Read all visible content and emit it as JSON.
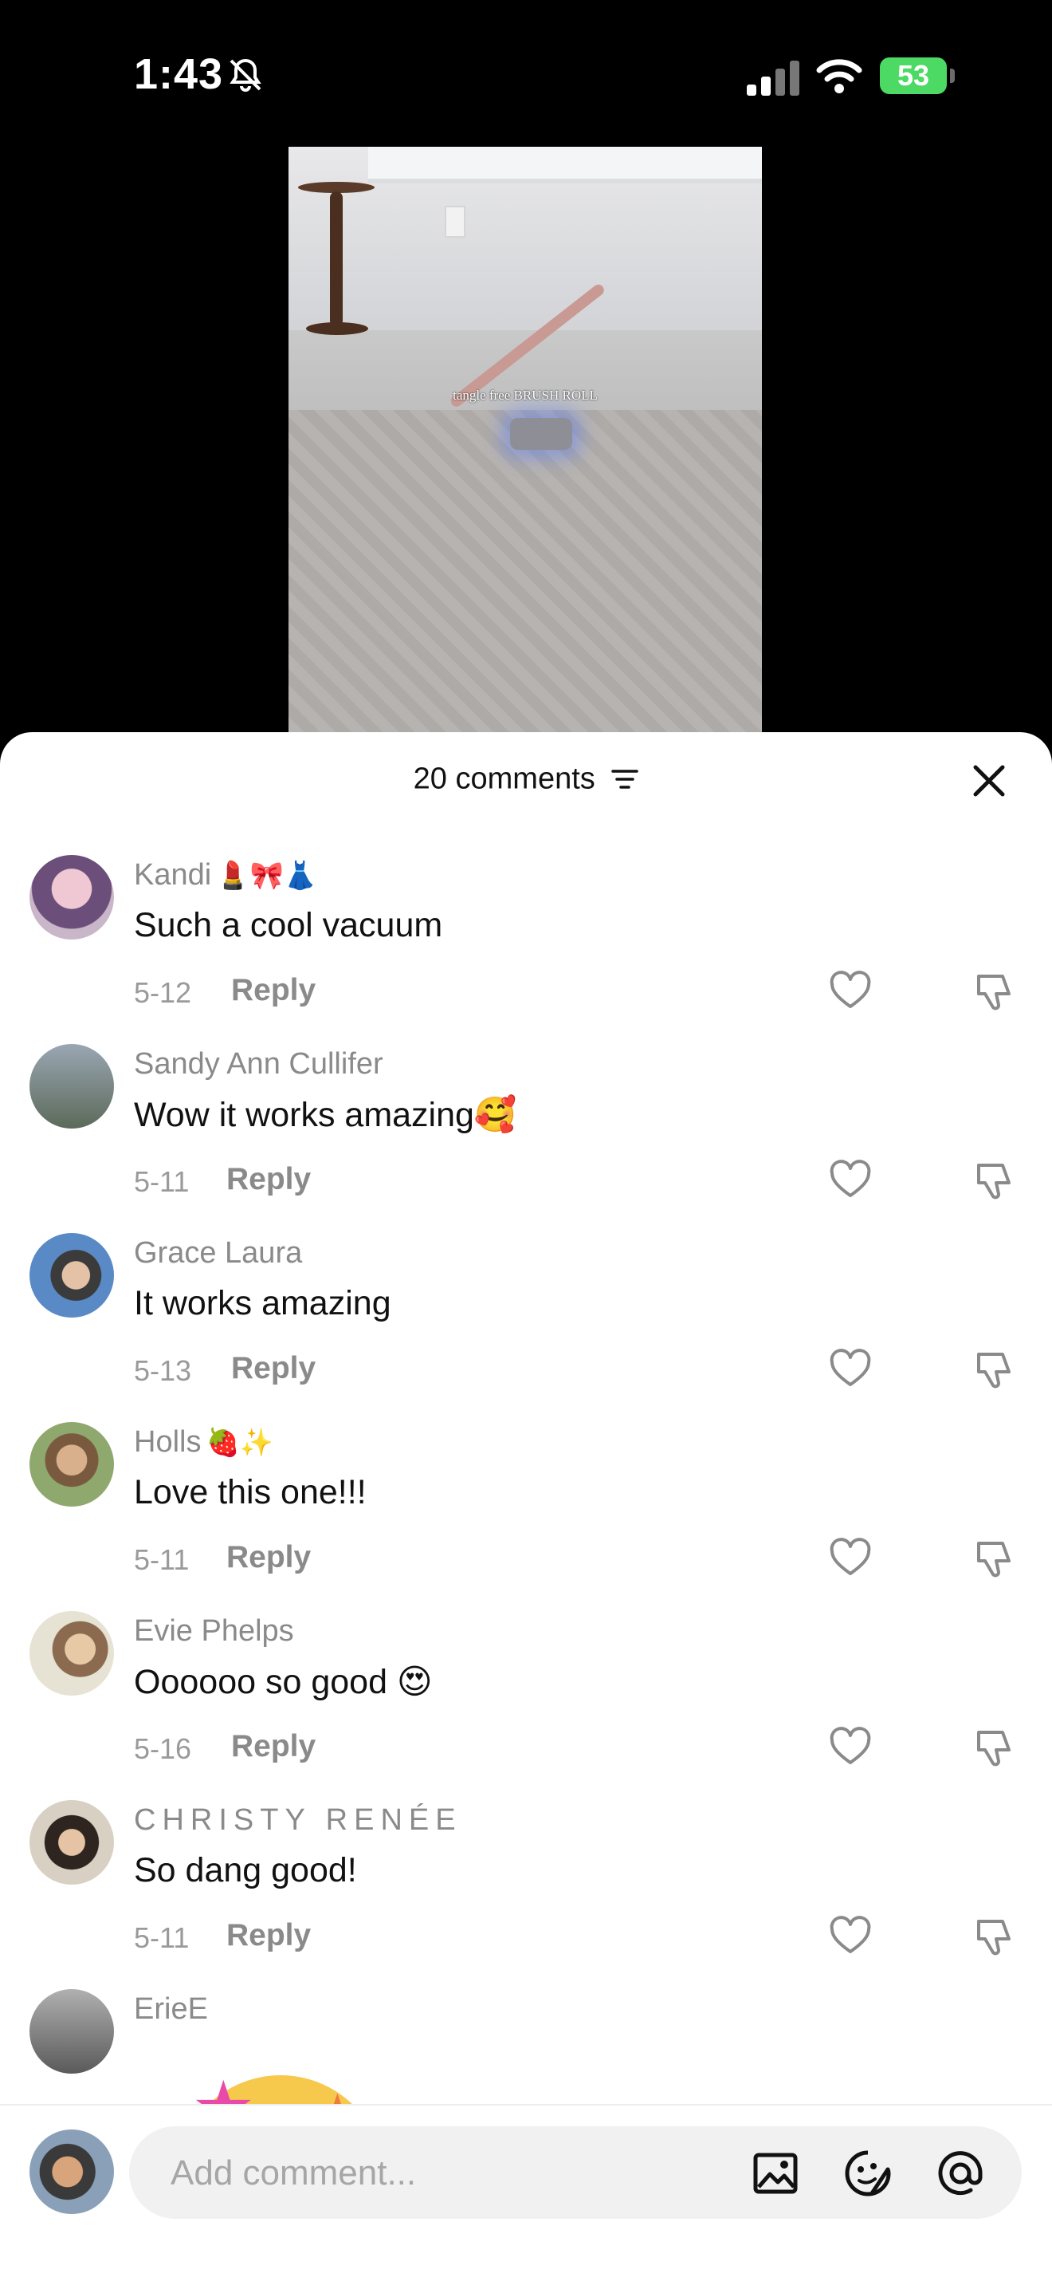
{
  "status_bar": {
    "time": "1:43",
    "battery": "53"
  },
  "video": {
    "caption": "tangle free BRUSH ROLL"
  },
  "sheet": {
    "count_label": "20 comments"
  },
  "comments": [
    {
      "user": "Kandi",
      "emoji": "💄🎀👗",
      "text": "Such a cool vacuum",
      "date": "5-12",
      "reply": "Reply"
    },
    {
      "user": "Sandy Ann Cullifer",
      "emoji": "",
      "text": "Wow it works amazing🥰",
      "date": "5-11",
      "reply": "Reply"
    },
    {
      "user": "Grace Laura",
      "emoji": "",
      "text": "It works amazing",
      "date": "5-13",
      "reply": "Reply"
    },
    {
      "user": "Holls",
      "emoji": "🍓✨",
      "text": "Love this one!!!",
      "date": "5-11",
      "reply": "Reply"
    },
    {
      "user": "Evie Phelps",
      "emoji": "",
      "text": "Oooooo so good 😍",
      "date": "5-16",
      "reply": "Reply"
    },
    {
      "user": "CHRISTY RENÉE",
      "emoji": "",
      "text": "So dang good!",
      "date": "5-11",
      "reply": "Reply"
    },
    {
      "user": "ErieE",
      "emoji": "",
      "text": "",
      "date": "",
      "reply": ""
    }
  ],
  "composer": {
    "placeholder": "Add comment..."
  },
  "colors": {
    "battery": "#4cd964",
    "text_primary": "#111111",
    "text_secondary": "#8a8a8a"
  }
}
